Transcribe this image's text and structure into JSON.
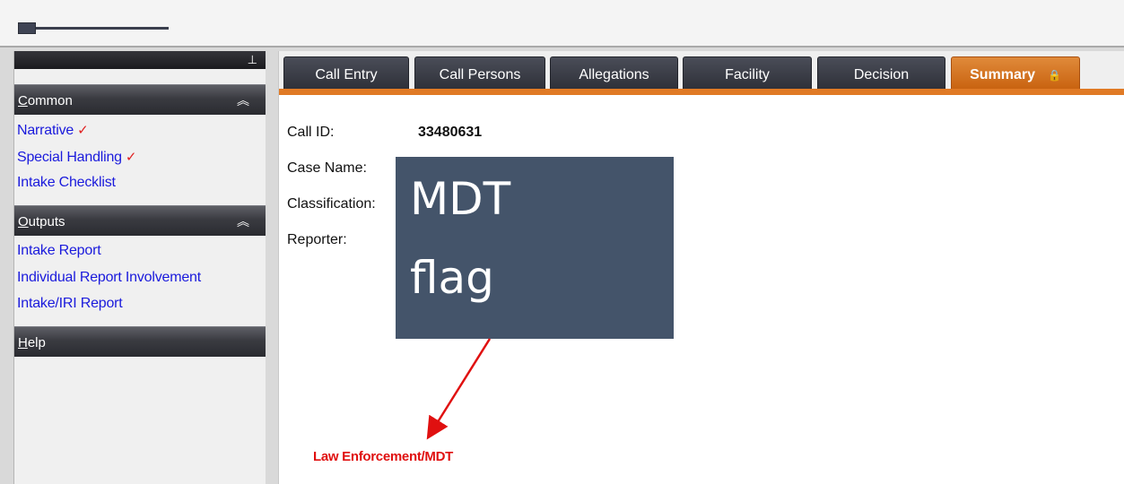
{
  "sidebar": {
    "sections": [
      {
        "title_first": "C",
        "title_rest": "ommon",
        "title": "Common"
      },
      {
        "title_first": "O",
        "title_rest": "utputs",
        "title": "Outputs"
      },
      {
        "title_first": "H",
        "title_rest": "elp",
        "title": "Help"
      }
    ],
    "common_items": [
      {
        "label": "Narrative",
        "checked": "✓"
      },
      {
        "label": "Special Handling",
        "checked": "✓"
      },
      {
        "label": "Intake Checklist"
      }
    ],
    "output_items": [
      {
        "label": "Intake Report"
      },
      {
        "label": "Individual Report Involvement"
      },
      {
        "label": "Intake/IRI Report"
      }
    ]
  },
  "tabs": [
    {
      "label": "Call Entry"
    },
    {
      "label": "Call Persons"
    },
    {
      "label": "Allegations"
    },
    {
      "label": "Facility"
    },
    {
      "label": "Decision"
    },
    {
      "label": "Summary",
      "active": true
    }
  ],
  "summary": {
    "call_id_label": "Call ID:",
    "call_id_value": "33480631",
    "case_name_label": "Case Name:",
    "classification_label": "Classification:",
    "reporter_label": "Reporter:",
    "law_enforcement_flag": "Law Enforcement/MDT"
  },
  "callout": {
    "line1": "MDT",
    "line2": "flag"
  },
  "colors": {
    "active_tab": "#c8620f",
    "inactive_tab": "#2e3038",
    "link": "#1a1adc",
    "flag_text": "#e01010",
    "callout_bg": "#44546a",
    "arrow": "#e01010"
  }
}
